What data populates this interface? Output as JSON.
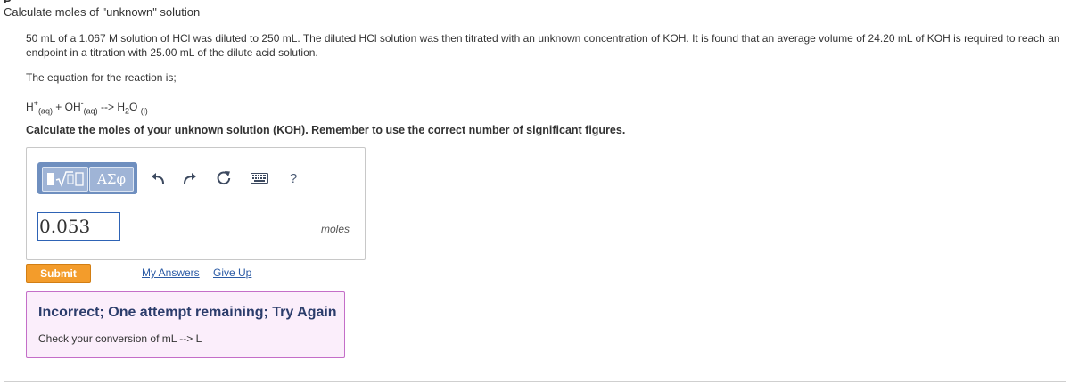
{
  "part": {
    "title": "Calculate moles of \"unknown\" solution"
  },
  "problem": {
    "statement": "50 mL of a 1.067 M solution of HCl was diluted to 250 mL. The diluted HCl solution was then titrated with an unknown concentration of KOH. It is found that an average volume of 24.20 mL of KOH is required to reach an endpoint in a titration with 25.00 mL of the dilute acid solution.",
    "equation_intro": "The equation for the reaction is;",
    "equation": {
      "h": "H",
      "h_sup": "+",
      "aq1": "(aq)",
      "plus": " + ",
      "oh": "OH",
      "oh_sup": "-",
      "aq2": "(aq)",
      "arrow": " --> ",
      "water": "H",
      "water_sub": "2",
      "water_o": "O",
      "liquid": "(l)"
    },
    "prompt": "Calculate the moles of your unknown solution (KOH). Remember to use the correct number of significant figures."
  },
  "toolbar": {
    "greek_label": "ΑΣφ",
    "help_label": "?"
  },
  "answer": {
    "value": "0.053",
    "units": "moles"
  },
  "actions": {
    "submit": "Submit",
    "my_answers": "My Answers",
    "give_up": "Give Up"
  },
  "feedback": {
    "title": "Incorrect; One attempt remaining; Try Again",
    "hint": "Check your conversion of mL --> L"
  },
  "colors": {
    "submit": "#f39c2b",
    "link": "#2a5aa5",
    "feedback_bg": "#fbeefb",
    "feedback_border": "#c46ec8",
    "toolbar": "#6f8fbf"
  }
}
